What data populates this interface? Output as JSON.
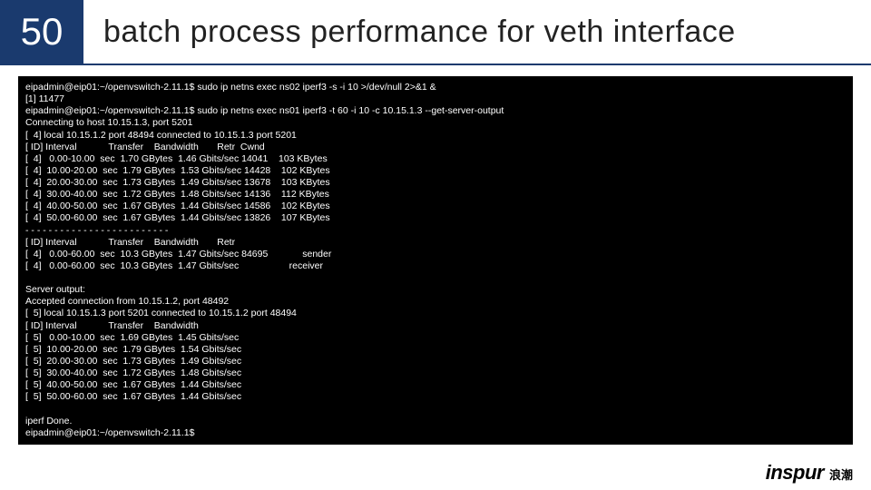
{
  "slide": {
    "number": "50",
    "title": "batch process performance for veth interface"
  },
  "terminal": {
    "block": "eipadmin@eip01:~/openvswitch-2.11.1$ sudo ip netns exec ns02 iperf3 -s -i 10 >/dev/null 2>&1 &\n[1] 11477\neipadmin@eip01:~/openvswitch-2.11.1$ sudo ip netns exec ns01 iperf3 -t 60 -i 10 -c 10.15.1.3 --get-server-output\nConnecting to host 10.15.1.3, port 5201\n[  4] local 10.15.1.2 port 48494 connected to 10.15.1.3 port 5201\n[ ID] Interval            Transfer    Bandwidth       Retr  Cwnd\n[  4]   0.00-10.00  sec  1.70 GBytes  1.46 Gbits/sec 14041    103 KBytes\n[  4]  10.00-20.00  sec  1.79 GBytes  1.53 Gbits/sec 14428    102 KBytes\n[  4]  20.00-30.00  sec  1.73 GBytes  1.49 Gbits/sec 13678    103 KBytes\n[  4]  30.00-40.00  sec  1.72 GBytes  1.48 Gbits/sec 14136    112 KBytes\n[  4]  40.00-50.00  sec  1.67 GBytes  1.44 Gbits/sec 14586    102 KBytes\n[  4]  50.00-60.00  sec  1.67 GBytes  1.44 Gbits/sec 13826    107 KBytes\n- - - - - - - - - - - - - - - - - - - - - - - - -\n[ ID] Interval            Transfer    Bandwidth       Retr\n[  4]   0.00-60.00  sec  10.3 GBytes  1.47 Gbits/sec 84695             sender\n[  4]   0.00-60.00  sec  10.3 GBytes  1.47 Gbits/sec                   receiver\n\nServer output:\nAccepted connection from 10.15.1.2, port 48492\n[  5] local 10.15.1.3 port 5201 connected to 10.15.1.2 port 48494\n[ ID] Interval            Transfer    Bandwidth\n[  5]   0.00-10.00  sec  1.69 GBytes  1.45 Gbits/sec\n[  5]  10.00-20.00  sec  1.79 GBytes  1.54 Gbits/sec\n[  5]  20.00-30.00  sec  1.73 GBytes  1.49 Gbits/sec\n[  5]  30.00-40.00  sec  1.72 GBytes  1.48 Gbits/sec\n[  5]  40.00-50.00  sec  1.67 GBytes  1.44 Gbits/sec\n[  5]  50.00-60.00  sec  1.67 GBytes  1.44 Gbits/sec\n\niperf Done.\neipadmin@eip01:~/openvswitch-2.11.1$"
  },
  "footer": {
    "logo_en": "inspur",
    "logo_cn": "浪潮"
  }
}
